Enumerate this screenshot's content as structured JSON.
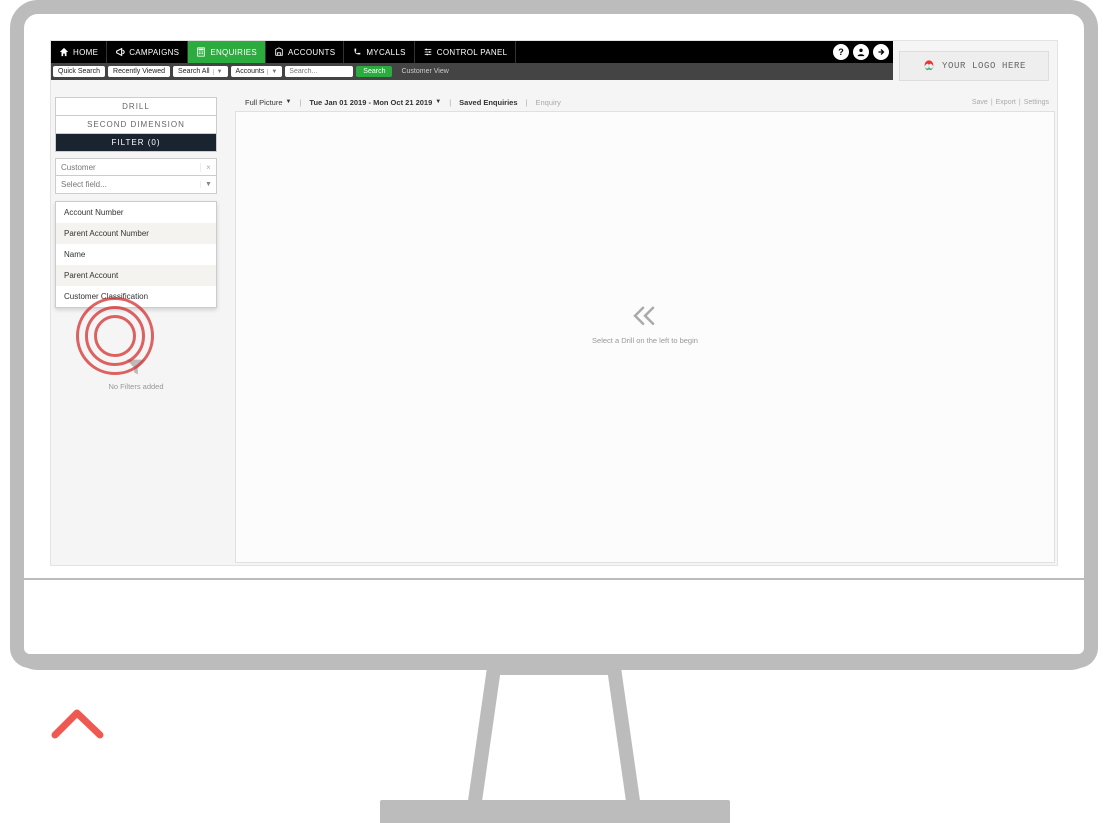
{
  "nav": {
    "items": [
      {
        "label": "HOME"
      },
      {
        "label": "CAMPAIGNS"
      },
      {
        "label": "ENQUIRIES"
      },
      {
        "label": "ACCOUNTS"
      },
      {
        "label": "MYCALLS"
      },
      {
        "label": "CONTROL PANEL"
      }
    ]
  },
  "searchbar": {
    "quick": "Quick Search",
    "recent": "Recently Viewed",
    "search_all": "Search All",
    "accounts": "Accounts",
    "placeholder": "Search...",
    "search_btn": "Search",
    "customer_view": "Customer View"
  },
  "logo": {
    "text": "YOUR LOGO HERE"
  },
  "crumb": {
    "full_picture": "Full Picture",
    "date_range": "Tue Jan 01 2019 - Mon Oct 21 2019",
    "saved": "Saved Enquiries",
    "enquiry": "Enquiry",
    "save": "Save",
    "export": "Export",
    "settings": "Settings"
  },
  "side": {
    "tabs": [
      "DRILL",
      "SECOND DIMENSION",
      "FILTER (0)"
    ],
    "customer": "Customer",
    "select_placeholder": "Select field...",
    "dropdown": [
      "Account Number",
      "Parent Account Number",
      "Name",
      "Parent Account",
      "Customer Classification"
    ],
    "no_filters": "No Filters added"
  },
  "main": {
    "hint": "Select a Drill on the left to begin"
  }
}
